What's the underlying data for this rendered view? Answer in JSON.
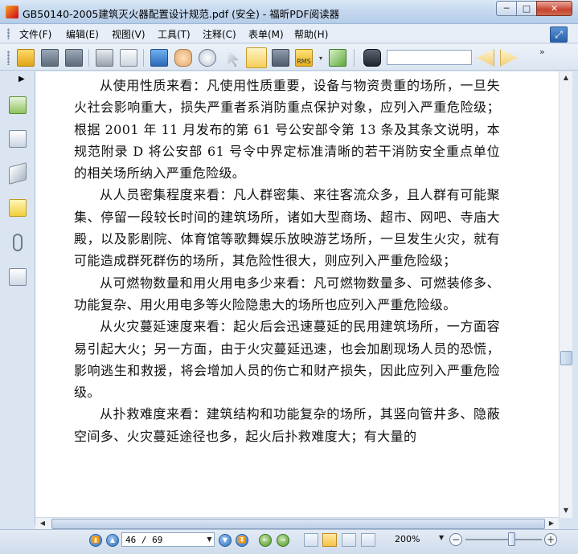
{
  "window": {
    "title": "GB50140-2005建筑灭火器配置设计规范.pdf (安全) - 福昕PDF阅读器",
    "controls": {
      "minimize": "─",
      "maximize": "□",
      "close": "✕"
    }
  },
  "menu": {
    "items": [
      {
        "label": "文件(F)",
        "icon": "none"
      },
      {
        "label": "编辑(E)",
        "icon": "none"
      },
      {
        "label": "视图(V)",
        "icon": "none"
      },
      {
        "label": "工具(T)",
        "icon": "none"
      },
      {
        "label": "注释(C)",
        "icon": "none"
      },
      {
        "label": "表单(M)",
        "icon": "none"
      },
      {
        "label": "帮助(H)",
        "icon": "none"
      }
    ],
    "corner_icon": "⤢"
  },
  "toolbar": {
    "icons": [
      "open-icon",
      "save-icon",
      "save-as-icon",
      "print-icon",
      "email-icon",
      "fullscreen-icon",
      "hand-tool-icon",
      "zoom-tool-icon",
      "select-arrow-icon",
      "text-select-icon",
      "snapshot-icon",
      "rms-icon",
      "sign-icon",
      "find-binoculars-icon",
      "find-prev-icon",
      "find-next-icon"
    ],
    "search_value": "",
    "more": "»",
    "rms_label": "RMS"
  },
  "sidebar": {
    "toggle": "▶",
    "icons": [
      "bookmarks-icon",
      "pages-icon",
      "layers-icon",
      "comments-icon",
      "attachments-icon",
      "signatures-icon"
    ]
  },
  "document": {
    "paragraphs": [
      "从使用性质来看：凡使用性质重要，设备与物资贵重的场所，一旦失火社会影响重大，损失严重者系消防重点保护对象，应列入严重危险级；根据 2001 年 11 月发布的第 61 号公安部令第 13 条及其条文说明，本规范附录 D 将公安部 61 号令中界定标准清晰的若干消防安全重点单位的相关场所纳入严重危险级。",
      "从人员密集程度来看：凡人群密集、来往客流众多，且人群有可能聚集、停留一段较长时间的建筑场所，诸如大型商场、超市、网吧、寺庙大殿，以及影剧院、体育馆等歌舞娱乐放映游艺场所，一旦发生火灾，就有可能造成群死群伤的场所，其危险性很大，则应列入严重危险级；",
      "从可燃物数量和用火用电多少来看：凡可燃物数量多、可燃装修多、功能复杂、用火用电多等火险隐患大的场所也应列入严重危险级。",
      "从火灾蔓延速度来看：起火后会迅速蔓延的民用建筑场所，一方面容易引起大火；另一方面，由于火灾蔓延迅速，也会加剧现场人员的恐慌，影响逃生和救援，将会增加人员的伤亡和财产损失，因此应列入严重危险级。",
      "从扑救难度来看：建筑结构和功能复杂的场所，其竖向管井多、隐蔽空间多、火灾蔓延途径也多，起火后扑救难度大；有大量的"
    ]
  },
  "statusbar": {
    "first_page": "⏫",
    "prev_page": "▲",
    "page_display": "46 / 69",
    "next_page": "▼",
    "last_page": "⏬",
    "back": "←",
    "forward": "→",
    "zoom": "200%",
    "zoom_out": "−",
    "zoom_in": "+",
    "active_view": "single-page",
    "colors": {
      "accent": "#2e6fbf",
      "active_view": "#f5c24a"
    }
  }
}
